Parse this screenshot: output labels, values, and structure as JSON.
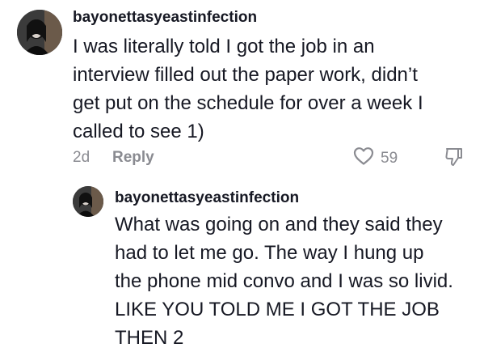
{
  "comments": [
    {
      "username": "bayonettasyeastinfection",
      "lines": [
        "I was literally told I got the job in an",
        "interview filled out the paper work, didn’t",
        "get put on the schedule for over a week I",
        "called to see 1)"
      ],
      "age": "2d",
      "reply_label": "Reply",
      "like_count": "59",
      "icons": {
        "like": "heart-outline-icon",
        "dislike": "thumbs-down-icon"
      }
    }
  ],
  "replies": [
    {
      "username": "bayonettasyeastinfection",
      "lines": [
        "What was going on and they said they",
        "had to let me go. The way I hung up",
        "the phone mid convo and I was so livid.",
        "LIKE YOU TOLD ME I GOT THE JOB",
        "THEN 2"
      ]
    }
  ],
  "colors": {
    "text": "#161823",
    "muted": "#8a8b91",
    "background": "#ffffff"
  }
}
